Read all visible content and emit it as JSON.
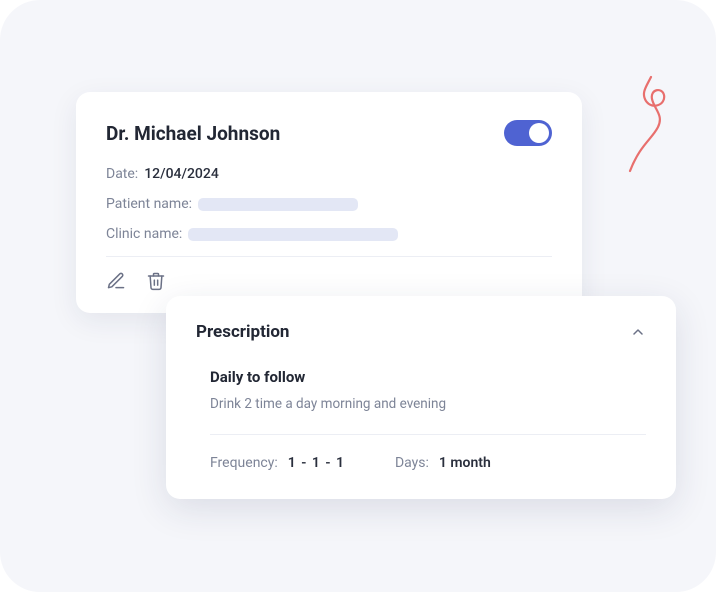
{
  "doctor": {
    "name": "Dr. Michael Johnson"
  },
  "toggle": {
    "on": true
  },
  "fields": {
    "date_label": "Date:",
    "date_value": "12/04/2024",
    "patient_label": "Patient name:",
    "clinic_label": "Clinic name:"
  },
  "icons": {
    "edit": "edit-icon",
    "delete": "trash-icon",
    "chevron": "chevron-up-icon"
  },
  "prescription": {
    "title": "Prescription",
    "daily_title": "Daily to follow",
    "daily_desc": "Drink 2 time a day morning and evening",
    "frequency_label": "Frequency:",
    "frequency_value": "1 - 1 - 1",
    "days_label": "Days:",
    "days_value": "1 month"
  },
  "colors": {
    "accent": "#4f63d2",
    "squiggle": "#e86f6d"
  }
}
